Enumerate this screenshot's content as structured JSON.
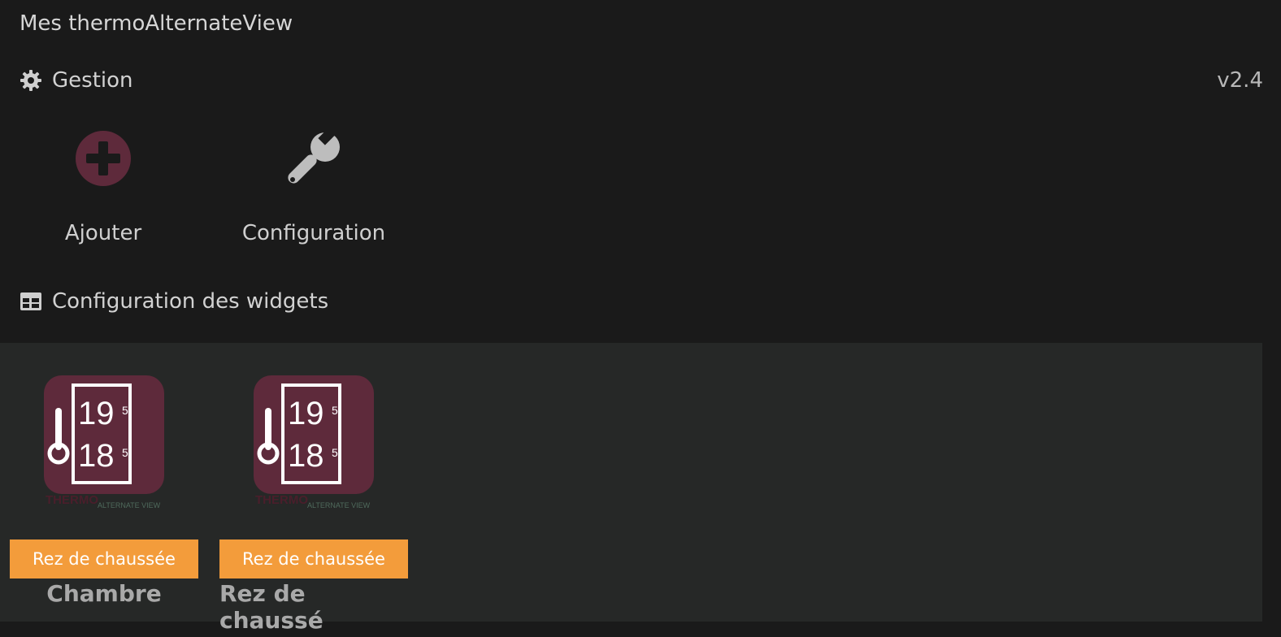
{
  "header": {
    "title": "Mes thermoAlternateView",
    "version": "v2.4"
  },
  "gestion": {
    "title": "Gestion",
    "icon": "gear-icon",
    "actions": [
      {
        "label": "Ajouter",
        "icon": "plus-circle-icon",
        "color": "#5e2a3b"
      },
      {
        "label": "Configuration",
        "icon": "wrench-icon",
        "color": "#bdbdbd"
      }
    ]
  },
  "widgets_section": {
    "title": "Configuration des widgets",
    "icon": "table-icon"
  },
  "widgets": [
    {
      "object": "Rez de chaussée",
      "name": "Chambre",
      "logo": {
        "line1": "19",
        "line2": "18",
        "sup": "5",
        "brand": "THERMO",
        "sub": "ALTERNATE VIEW"
      }
    },
    {
      "object": "Rez de chaussée",
      "name": "Rez de chaussé",
      "logo": {
        "line1": "19",
        "line2": "18",
        "sup": "5",
        "brand": "THERMO",
        "sub": "ALTERNATE VIEW"
      }
    }
  ],
  "colors": {
    "accent_orange": "#f39c3b",
    "logo_bg": "#5e2a3b",
    "panel_bg": "#262827",
    "page_bg": "#1a1a1a"
  }
}
